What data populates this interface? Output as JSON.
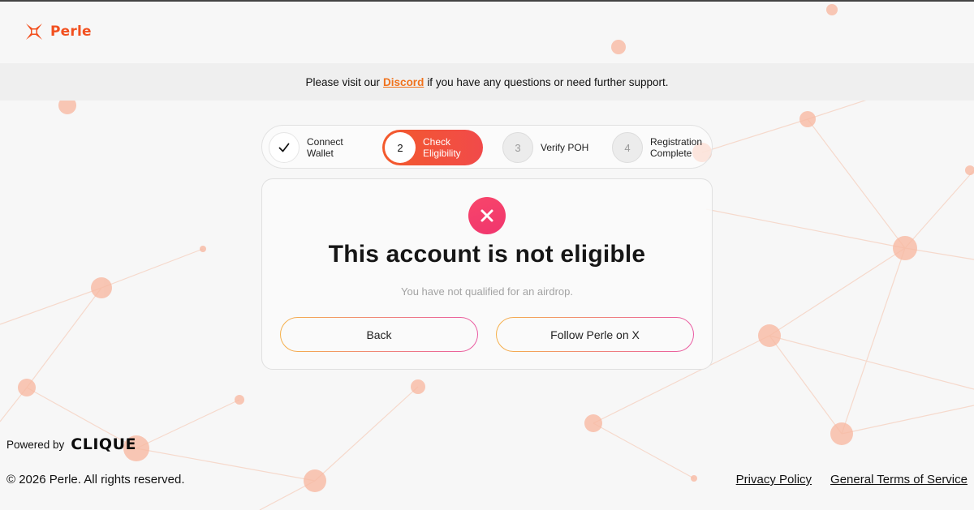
{
  "brand": {
    "name": "Perle",
    "color": "#f2501f"
  },
  "notice": {
    "prefix": "Please visit our",
    "link": "Discord",
    "suffix": "if you have any questions or need further support."
  },
  "steps": [
    {
      "number": "1",
      "label": "Connect Wallet",
      "state": "completed",
      "icon": "check-icon"
    },
    {
      "number": "2",
      "label": "Check Eligibility",
      "state": "active"
    },
    {
      "number": "3",
      "label": "Verify POH",
      "state": "pending"
    },
    {
      "number": "4",
      "label": "Registration Complete",
      "state": "pending"
    }
  ],
  "result": {
    "icon": "close-icon",
    "title": "This account is not eligible",
    "subtitle": "You have not qualified for an airdrop.",
    "back_label": "Back",
    "follow_label": "Follow Perle on X"
  },
  "footer": {
    "powered_by": "Powered by",
    "powered_brand": "CLIQUE",
    "copyright": "© 2026 Perle. All rights reserved.",
    "privacy": "Privacy Policy",
    "terms": "General Terms of Service"
  },
  "colors": {
    "accent": "#f35a2c",
    "error": "#f0356e",
    "link": "#f0721c"
  }
}
